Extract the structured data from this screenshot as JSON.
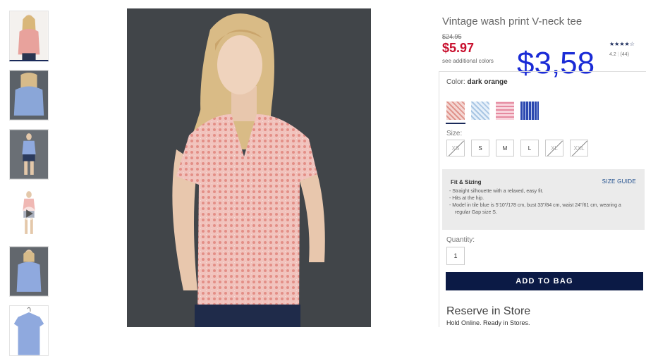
{
  "product": {
    "title": "Vintage wash print V-neck tee",
    "original_price": "$24.95",
    "sale_price": "$5.97",
    "see_colors": "see additional colors",
    "overlay_price": "$3,58",
    "stars": "★★★★☆",
    "rating_value": "4.2",
    "rating_count": "(44)"
  },
  "color": {
    "label": "Color:",
    "selected": "dark orange",
    "swatches": [
      {
        "name": "dark orange",
        "color": "#e8b4b0"
      },
      {
        "name": "light blue",
        "color": "#cfe0f0"
      },
      {
        "name": "pink",
        "color": "#f3b9c6"
      },
      {
        "name": "blue",
        "color": "#3552b8"
      }
    ]
  },
  "size": {
    "label": "Size:",
    "options": [
      "XS",
      "S",
      "M",
      "L",
      "XL",
      "XXL"
    ]
  },
  "fit": {
    "title": "Fit & Sizing",
    "size_guide": "SIZE GUIDE",
    "items": [
      "- Straight silhouette with a relaxed, easy fit.",
      "- Hits at the hip.",
      "- Model in tile blue is 5'10\"/178 cm, bust 33\"/84 cm, waist 24\"/61 cm, wearing a regular Gap size S."
    ]
  },
  "quantity": {
    "label": "Quantity:",
    "value": "1"
  },
  "add_to_bag": "ADD TO BAG",
  "reserve": {
    "title": "Reserve in Store",
    "subtitle": "Hold Online. Ready in Stores."
  }
}
